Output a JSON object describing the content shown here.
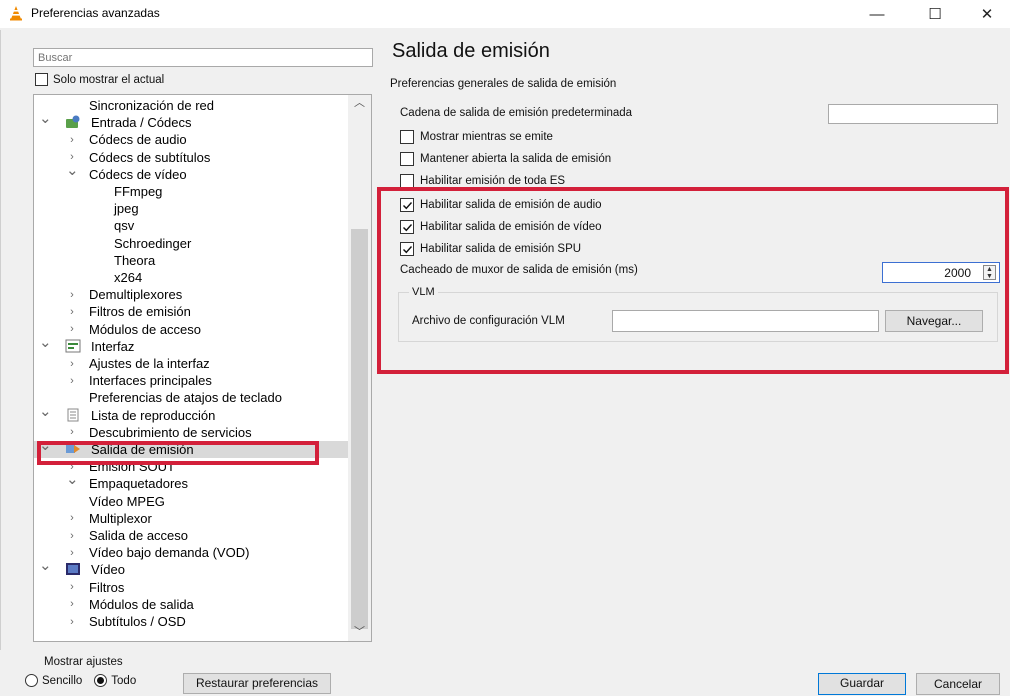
{
  "window": {
    "title": "Preferencias avanzadas",
    "minimize": "—",
    "maximize": "☐",
    "close": "✕"
  },
  "search": {
    "placeholder": "Buscar"
  },
  "solo_mostrar": {
    "label": "Solo mostrar el actual",
    "checked": false
  },
  "tree": {
    "items": [
      {
        "label": "Sincronización de red",
        "level": 2,
        "arrow": ""
      },
      {
        "label": "Entrada / Códecs",
        "level": 0,
        "arrow": "v",
        "icon": "input-codecs-icon"
      },
      {
        "label": "Códecs de audio",
        "level": 1,
        "arrow": ">"
      },
      {
        "label": "Códecs de subtítulos",
        "level": 1,
        "arrow": ">"
      },
      {
        "label": "Códecs de vídeo",
        "level": 1,
        "arrow": "v"
      },
      {
        "label": "FFmpeg",
        "level": 3,
        "arrow": ""
      },
      {
        "label": "jpeg",
        "level": 3,
        "arrow": ""
      },
      {
        "label": "qsv",
        "level": 3,
        "arrow": ""
      },
      {
        "label": "Schroedinger",
        "level": 3,
        "arrow": ""
      },
      {
        "label": "Theora",
        "level": 3,
        "arrow": ""
      },
      {
        "label": "x264",
        "level": 3,
        "arrow": ""
      },
      {
        "label": "Demultiplexores",
        "level": 1,
        "arrow": ">"
      },
      {
        "label": "Filtros de emisión",
        "level": 1,
        "arrow": ">"
      },
      {
        "label": "Módulos de acceso",
        "level": 1,
        "arrow": ">"
      },
      {
        "label": "Interfaz",
        "level": 0,
        "arrow": "v",
        "icon": "interface-icon"
      },
      {
        "label": "Ajustes de la interfaz",
        "level": 1,
        "arrow": ">"
      },
      {
        "label": "Interfaces principales",
        "level": 1,
        "arrow": ">"
      },
      {
        "label": "Preferencias de atajos de teclado",
        "level": 2,
        "arrow": ""
      },
      {
        "label": "Lista de reproducción",
        "level": 0,
        "arrow": "v",
        "icon": "playlist-icon"
      },
      {
        "label": "Descubrimiento de servicios",
        "level": 1,
        "arrow": ">"
      },
      {
        "label": "Salida de emisión",
        "level": 0,
        "arrow": "v",
        "icon": "stream-output-icon",
        "selected": true
      },
      {
        "label": "Emisión SOUT",
        "level": 1,
        "arrow": ">"
      },
      {
        "label": "Empaquetadores",
        "level": 1,
        "arrow": "v"
      },
      {
        "label": "Vídeo MPEG",
        "level": 2,
        "arrow": ""
      },
      {
        "label": "Multiplexor",
        "level": 1,
        "arrow": ">"
      },
      {
        "label": "Salida de acceso",
        "level": 1,
        "arrow": ">"
      },
      {
        "label": "Vídeo bajo demanda (VOD)",
        "level": 1,
        "arrow": ">"
      },
      {
        "label": "Vídeo",
        "level": 0,
        "arrow": "v",
        "icon": "video-icon"
      },
      {
        "label": "Filtros",
        "level": 1,
        "arrow": ">"
      },
      {
        "label": "Módulos de salida",
        "level": 1,
        "arrow": ">"
      },
      {
        "label": "Subtítulos / OSD",
        "level": 1,
        "arrow": ">"
      }
    ]
  },
  "main": {
    "title": "Salida de emisión",
    "subtitle": "Preferencias generales de salida de emisión",
    "cadena_label": "Cadena de salida de emisión predeterminada",
    "cadena_value": "",
    "options": [
      {
        "label": "Mostrar mientras se emite",
        "checked": false
      },
      {
        "label": "Mantener abierta la salida de emisión",
        "checked": false
      },
      {
        "label": "Habilitar emisión de toda ES",
        "checked": false
      },
      {
        "label": "Habilitar salida de emisión de audio",
        "checked": true
      },
      {
        "label": "Habilitar salida de emisión de vídeo",
        "checked": true
      },
      {
        "label": "Habilitar salida de emisión SPU",
        "checked": true
      }
    ],
    "cacheado_label": "Cacheado de muxor de salida de emisión (ms)",
    "cacheado_value": "2000",
    "vlm_legend": "VLM",
    "vlm_label": "Archivo de configuración VLM",
    "vlm_value": "",
    "navegar": "Navegar..."
  },
  "bottom": {
    "mostrar_legend": "Mostrar ajustes",
    "sencillo": "Sencillo",
    "todo": "Todo",
    "selected": "Todo",
    "restaurar": "Restaurar preferencias",
    "guardar": "Guardar",
    "cancelar": "Cancelar"
  },
  "colors": {
    "highlight": "#d3203a",
    "selected_row": "#d9d9d9"
  }
}
